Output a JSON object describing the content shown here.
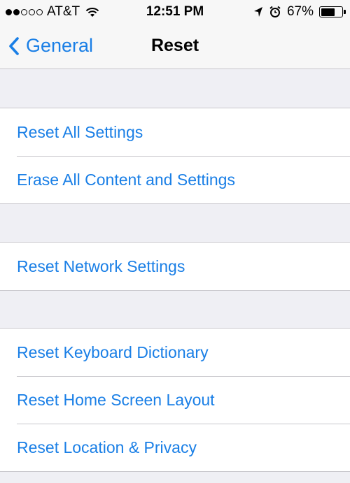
{
  "status_bar": {
    "carrier": "AT&T",
    "time": "12:51 PM",
    "battery": "67%",
    "battery_level": 0.67,
    "icons": [
      "signal-dots-icon",
      "wifi-icon",
      "location-arrow-icon",
      "alarm-icon",
      "battery-icon"
    ]
  },
  "nav": {
    "back_label": "General",
    "title": "Reset",
    "accent_color": "#1a7fe6"
  },
  "groups": [
    {
      "items": [
        {
          "label": "Reset All Settings"
        },
        {
          "label": "Erase All Content and Settings"
        }
      ]
    },
    {
      "items": [
        {
          "label": "Reset Network Settings"
        }
      ]
    },
    {
      "items": [
        {
          "label": "Reset Keyboard Dictionary"
        },
        {
          "label": "Reset Home Screen Layout"
        },
        {
          "label": "Reset Location & Privacy"
        }
      ]
    }
  ]
}
